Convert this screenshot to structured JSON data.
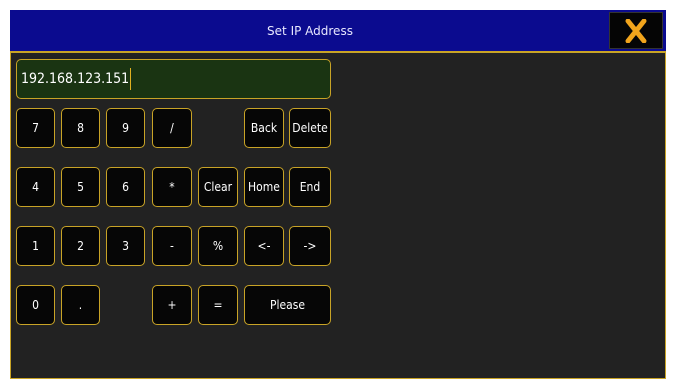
{
  "dialog": {
    "title": "Set IP Address",
    "close_icon": "close-x-icon"
  },
  "input": {
    "value": "192.168.123.151"
  },
  "colors": {
    "titlebar": "#0b0b8f",
    "panel": "#222222",
    "key_border": "#c8a326",
    "input_bg": "#1a3412",
    "close_x": "#f2a51c"
  },
  "keys": {
    "k7": "7",
    "k8": "8",
    "k9": "9",
    "slash": "/",
    "back": "Back",
    "delete": "Delete",
    "k4": "4",
    "k5": "5",
    "k6": "6",
    "star": "*",
    "clear": "Clear",
    "home": "Home",
    "end": "End",
    "k1": "1",
    "k2": "2",
    "k3": "3",
    "minus": "-",
    "percent": "%",
    "left": "<-",
    "right": "->",
    "k0": "0",
    "dot": ".",
    "plus": "+",
    "equals": "=",
    "please": "Please"
  }
}
